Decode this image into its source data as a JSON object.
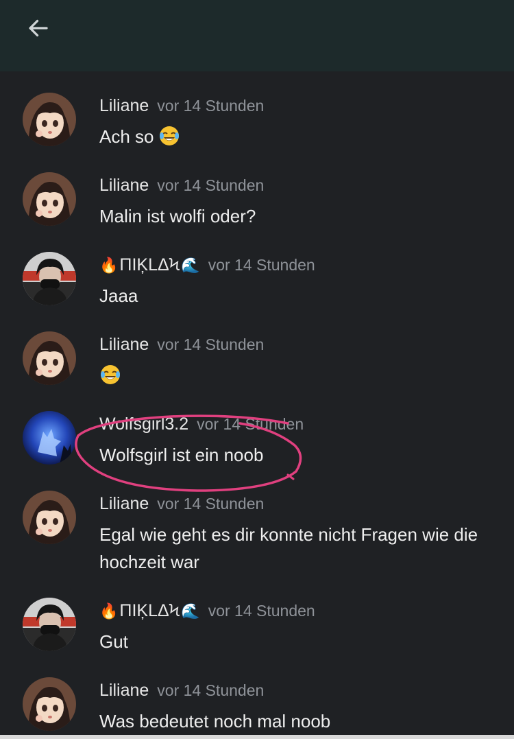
{
  "header": {
    "back_icon": "arrow-left-icon"
  },
  "messages": [
    {
      "username": "Liliane",
      "time": "vor 14 Stunden",
      "text": "Ach so",
      "emoji": "face-with-tears-of-joy",
      "avatar": "anime-girl"
    },
    {
      "username": "Liliane",
      "time": "vor 14 Stunden",
      "text": "Malin ist wolfi oder?",
      "avatar": "anime-girl"
    },
    {
      "username": "ΠΙĶLΔϞ",
      "username_prefix": "🔥",
      "username_suffix": "🌊",
      "time": "vor 14 Stunden",
      "text": "Jaaa",
      "avatar": "masked-boy"
    },
    {
      "username": "Liliane",
      "time": "vor 14 Stunden",
      "text": "",
      "emoji": "face-with-tears-of-joy",
      "avatar": "anime-girl"
    },
    {
      "username": "Wolfsgirl3.2",
      "time": "vor 14 Stunden",
      "text": "Wolfsgirl ist ein noob",
      "avatar": "blue-wolf",
      "annotated": true
    },
    {
      "username": "Liliane",
      "time": "vor 14 Stunden",
      "text": "Egal wie geht es dir konnte nicht Fragen wie die hochzeit war",
      "avatar": "anime-girl"
    },
    {
      "username": "ΠΙĶLΔϞ",
      "username_prefix": "🔥",
      "username_suffix": "🌊",
      "time": "vor 14 Stunden",
      "text": "Gut",
      "avatar": "masked-boy"
    },
    {
      "username": "Liliane",
      "time": "vor 14 Stunden",
      "text": "Was bedeutet noch mal noob",
      "avatar": "anime-girl"
    }
  ],
  "colors": {
    "background": "#1f2124",
    "header": "#1d2a2b",
    "annotation": "#e0407f"
  }
}
